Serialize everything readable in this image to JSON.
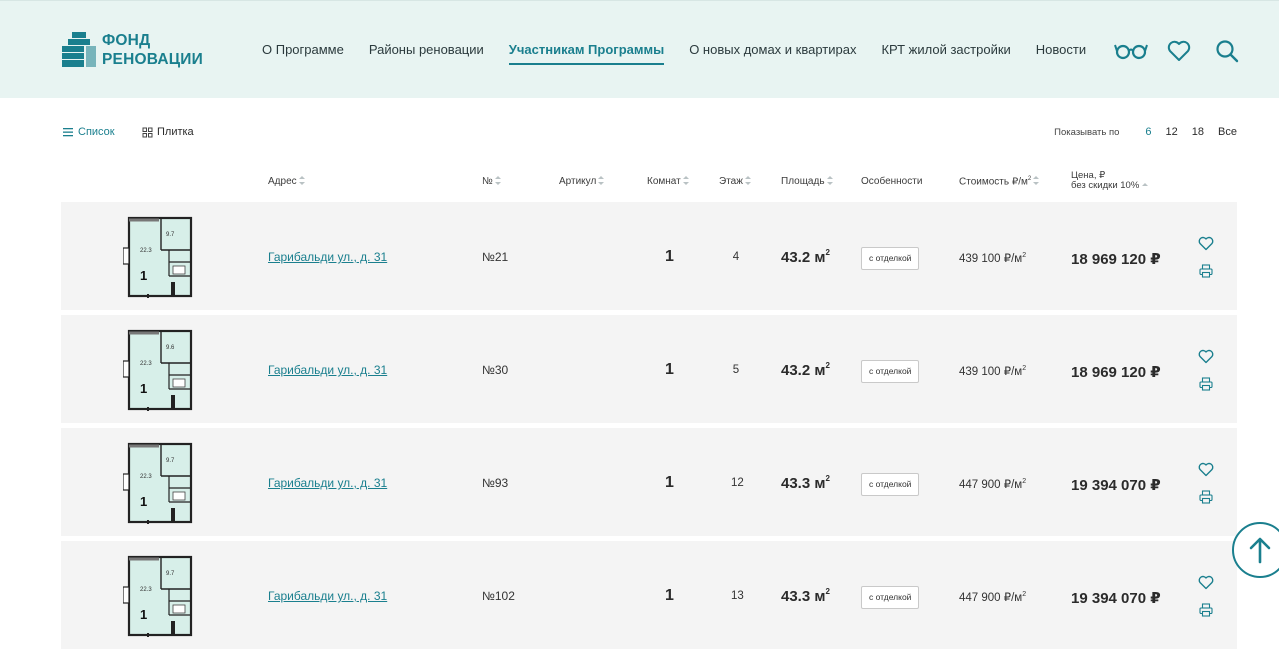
{
  "brand": {
    "line1": "ФОНД",
    "line2": "РЕНОВАЦИИ",
    "accent": "#1a7f8e"
  },
  "nav": [
    {
      "label": "О Программе",
      "active": false
    },
    {
      "label": "Районы реновации",
      "active": false
    },
    {
      "label": "Участникам Программы",
      "active": true
    },
    {
      "label": "О новых домах и квартирах",
      "active": false
    },
    {
      "label": "КРТ жилой застройки",
      "active": false
    },
    {
      "label": "Новости",
      "active": false
    }
  ],
  "header_icons": [
    "glasses-icon",
    "heart-icon",
    "search-icon"
  ],
  "toolbar": {
    "list_label": "Список",
    "tile_label": "Плитка",
    "per_page_label": "Показывать по",
    "per_page_options": [
      "6",
      "12",
      "18",
      "Все"
    ],
    "per_page_selected": "6"
  },
  "columns": {
    "address": "Адрес",
    "number": "№",
    "article": "Артикул",
    "rooms": "Комнат",
    "floor": "Этаж",
    "area": "Площадь",
    "features": "Особенности",
    "price_per_m": "Стоимость ₽/м",
    "price_per_m_sup": "2",
    "price_line1": "Цена, ₽",
    "price_line2": "без скидки 10%"
  },
  "rows": [
    {
      "address": "Гарибальди ул., д. 31",
      "number": "№21",
      "rooms": "1",
      "floor": "4",
      "area": "43.2 м",
      "area_sup": "2",
      "feature": "с отделкой",
      "ppm": "439 100 ₽/м",
      "ppm_sup": "2",
      "price": "18 969 120 ₽",
      "plan": {
        "big": "22.3",
        "small": "9.7",
        "rooms": "1"
      }
    },
    {
      "address": "Гарибальди ул., д. 31",
      "number": "№30",
      "rooms": "1",
      "floor": "5",
      "area": "43.2 м",
      "area_sup": "2",
      "feature": "с отделкой",
      "ppm": "439 100 ₽/м",
      "ppm_sup": "2",
      "price": "18 969 120 ₽",
      "plan": {
        "big": "22.3",
        "small": "9.6",
        "rooms": "1"
      }
    },
    {
      "address": "Гарибальди ул., д. 31",
      "number": "№93",
      "rooms": "1",
      "floor": "12",
      "area": "43.3 м",
      "area_sup": "2",
      "feature": "с отделкой",
      "ppm": "447 900 ₽/м",
      "ppm_sup": "2",
      "price": "19 394 070 ₽",
      "plan": {
        "big": "22.3",
        "small": "9.7",
        "rooms": "1"
      }
    },
    {
      "address": "Гарибальди ул., д. 31",
      "number": "№102",
      "rooms": "1",
      "floor": "13",
      "area": "43.3 м",
      "area_sup": "2",
      "feature": "с отделкой",
      "ppm": "447 900 ₽/м",
      "ppm_sup": "2",
      "price": "19 394 070 ₽",
      "plan": {
        "big": "22.3",
        "small": "9.7",
        "rooms": "1"
      }
    }
  ]
}
